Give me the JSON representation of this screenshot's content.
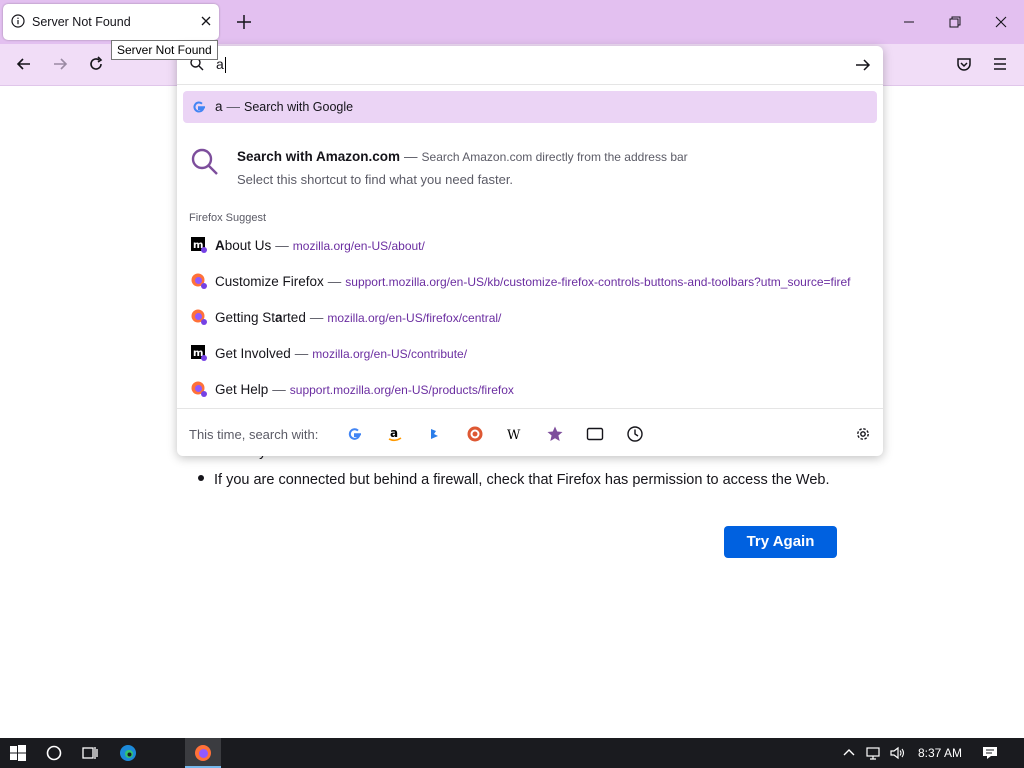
{
  "window": {
    "tab_title": "Server Not Found",
    "tooltip": "Server Not Found"
  },
  "urlbar": {
    "typed_value": "a"
  },
  "suggestions": {
    "search_google": {
      "query": "a",
      "label": "Search with Google"
    },
    "amazon": {
      "title": "Search with Amazon.com",
      "desc": "Search Amazon.com directly from the address bar",
      "sub": "Select this shortcut to find what you need faster."
    },
    "group_label": "Firefox Suggest",
    "items": [
      {
        "title_pre": "",
        "title_bold": "A",
        "title_post": "bout Us",
        "url": "mozilla.org/en-US/about/",
        "icon": "mozilla-icon"
      },
      {
        "title_pre": "Customize Firefox",
        "title_bold": "",
        "title_post": "",
        "url": "support.mozilla.org/en-US/kb/customize-firefox-controls-buttons-and-toolbars?utm_source=firef",
        "icon": "firefox-icon"
      },
      {
        "title_pre": "Getting St",
        "title_bold": "a",
        "title_post": "rted",
        "url": "mozilla.org/en-US/firefox/central/",
        "icon": "firefox-icon"
      },
      {
        "title_pre": "Get Involved",
        "title_bold": "",
        "title_post": "",
        "url": "mozilla.org/en-US/contribute/",
        "icon": "mozilla-icon"
      },
      {
        "title_pre": "Get Help",
        "title_bold": "",
        "title_post": "",
        "url": "support.mozilla.org/en-US/products/firefox",
        "icon": "firefox-icon"
      }
    ],
    "oneoff_label": "This time, search with:"
  },
  "page": {
    "bullet_partial": "Check your network connection.",
    "bullet": "If you are connected but behind a firewall, check that Firefox has permission to access the Web.",
    "try_again": "Try Again"
  },
  "taskbar": {
    "time": "8:37 AM"
  },
  "colors": {
    "accent": "#0061e0",
    "tabstrip": "#e3c0f0",
    "navbar": "#f1ddf7",
    "selected_row": "#ebd4f5",
    "url_text": "#6b2ea1"
  }
}
